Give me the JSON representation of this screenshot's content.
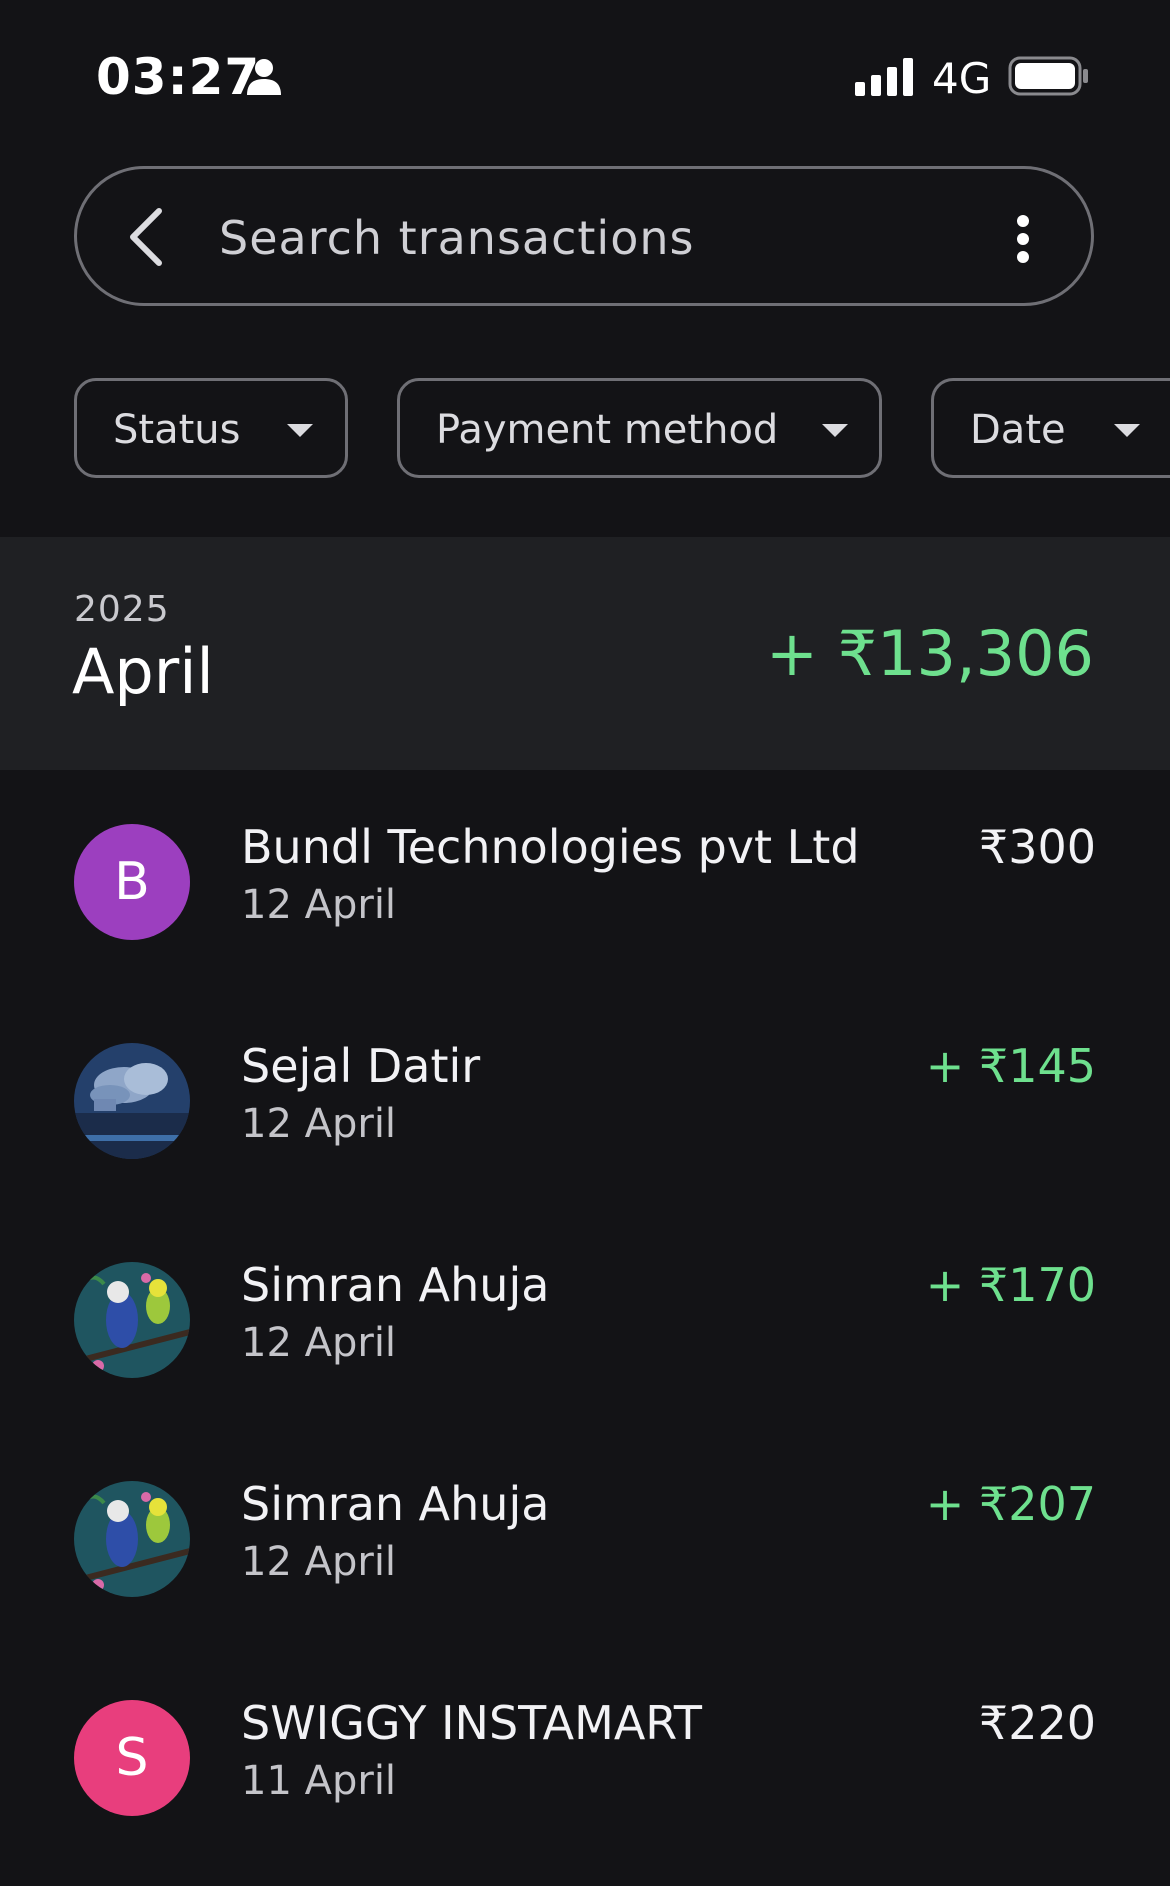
{
  "status_bar": {
    "time": "03:27",
    "network": "4G",
    "icons": [
      "person-icon",
      "signal-icon",
      "battery-icon"
    ]
  },
  "search": {
    "placeholder": "Search transactions",
    "icons": [
      "back-arrow-icon",
      "more-vert-icon"
    ]
  },
  "filters": [
    {
      "label": "Status"
    },
    {
      "label": "Payment method"
    },
    {
      "label": "Date"
    }
  ],
  "month_group": {
    "year": "2025",
    "month": "April",
    "total": "+ ₹13,306"
  },
  "transactions": [
    {
      "name": "Bundl Technologies pvt Ltd",
      "date": "12 April",
      "amount": "₹300",
      "type": "debit",
      "avatar": "B",
      "avatar_color": "#9c3fbf"
    },
    {
      "name": "Sejal Datir",
      "date": "12 April",
      "amount": "+ ₹145",
      "type": "credit",
      "avatar": "photo-clouds"
    },
    {
      "name": "Simran Ahuja",
      "date": "12 April",
      "amount": "+ ₹170",
      "type": "credit",
      "avatar": "photo-birds"
    },
    {
      "name": "Simran Ahuja",
      "date": "12 April",
      "amount": "+ ₹207",
      "type": "credit",
      "avatar": "photo-birds"
    },
    {
      "name": "SWIGGY INSTAMART",
      "date": "11 April",
      "amount": "₹220",
      "type": "debit",
      "avatar": "S",
      "avatar_color": "#e83e7d"
    }
  ],
  "colors": {
    "background": "#131316",
    "header_band": "#1f2023",
    "credit_green": "#6ee08e",
    "outline": "#6f6f75"
  }
}
